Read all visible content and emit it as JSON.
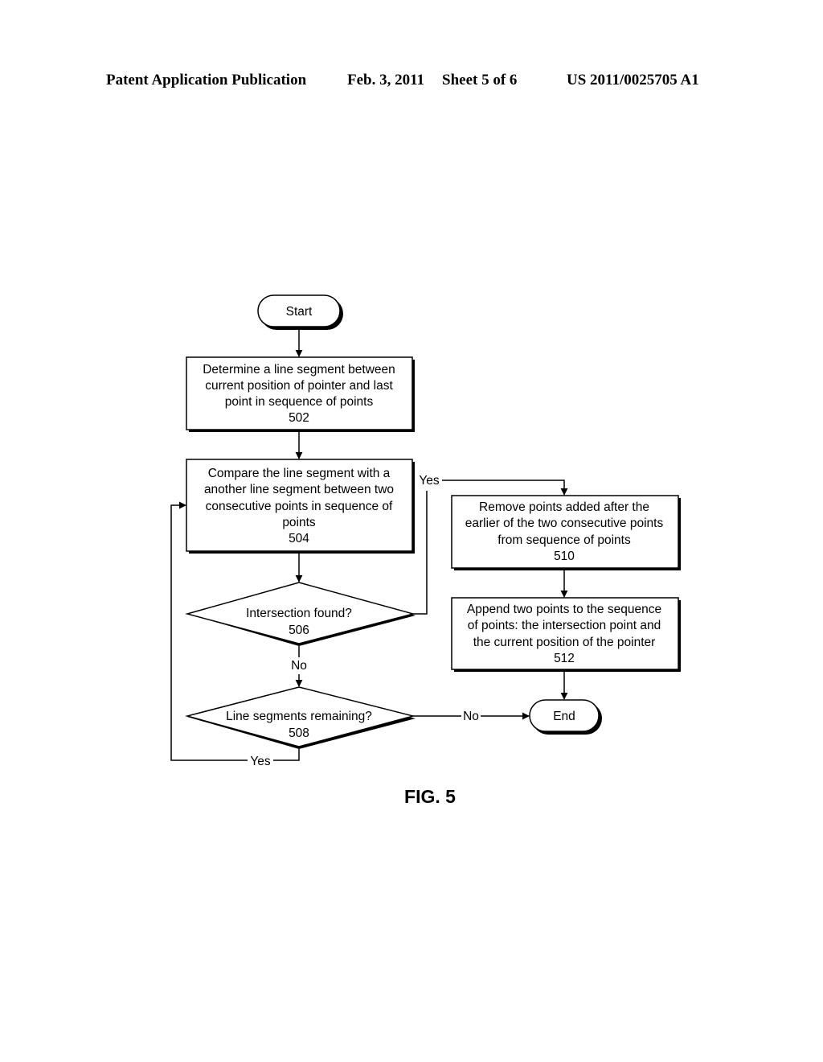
{
  "header": {
    "publication": "Patent Application Publication",
    "date": "Feb. 3, 2011",
    "sheet": "Sheet 5 of 6",
    "number": "US 2011/0025705 A1"
  },
  "flowchart": {
    "start": "Start",
    "end": "End",
    "steps": {
      "s502": {
        "lines": [
          "Determine a line segment between",
          "current position of pointer and last",
          "point in sequence of points"
        ],
        "ref": "502"
      },
      "s504": {
        "lines": [
          "Compare the line segment with a",
          "another line segment between two",
          "consecutive points in sequence of",
          "points"
        ],
        "ref": "504"
      },
      "s506": {
        "lines": [
          "Intersection found?"
        ],
        "ref": "506"
      },
      "s508": {
        "lines": [
          "Line segments remaining?"
        ],
        "ref": "508"
      },
      "s510": {
        "lines": [
          "Remove points added after the",
          "earlier of the two consecutive points",
          "from sequence of points"
        ],
        "ref": "510"
      },
      "s512": {
        "lines": [
          "Append two points to the sequence",
          "of points: the intersection point and",
          "the current position of the pointer"
        ],
        "ref": "512"
      }
    },
    "edge_labels": {
      "yes_506": "Yes",
      "no_506": "No",
      "no_508": "No",
      "yes_508": "Yes"
    }
  },
  "figure_label": "FIG. 5"
}
